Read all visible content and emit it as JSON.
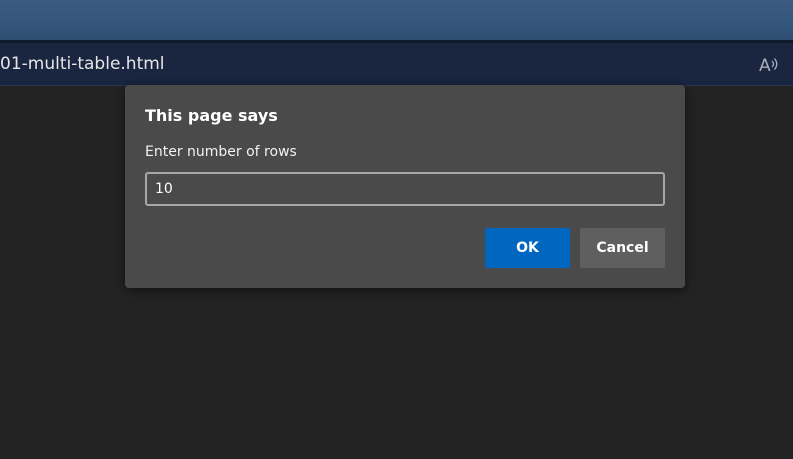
{
  "browser": {
    "url_text": "01-multi-table.html",
    "read_aloud_icon": "read-aloud-icon"
  },
  "dialog": {
    "title": "This page says",
    "message": "Enter number of rows",
    "input_value": "10",
    "ok_label": "OK",
    "cancel_label": "Cancel"
  },
  "colors": {
    "tabstrip": "#34567a",
    "address_bar": "#1a2540",
    "page_background": "#232323",
    "dialog_background": "#4a4a4a",
    "ok_button": "#0067c0",
    "cancel_button": "#5f5f5f"
  }
}
